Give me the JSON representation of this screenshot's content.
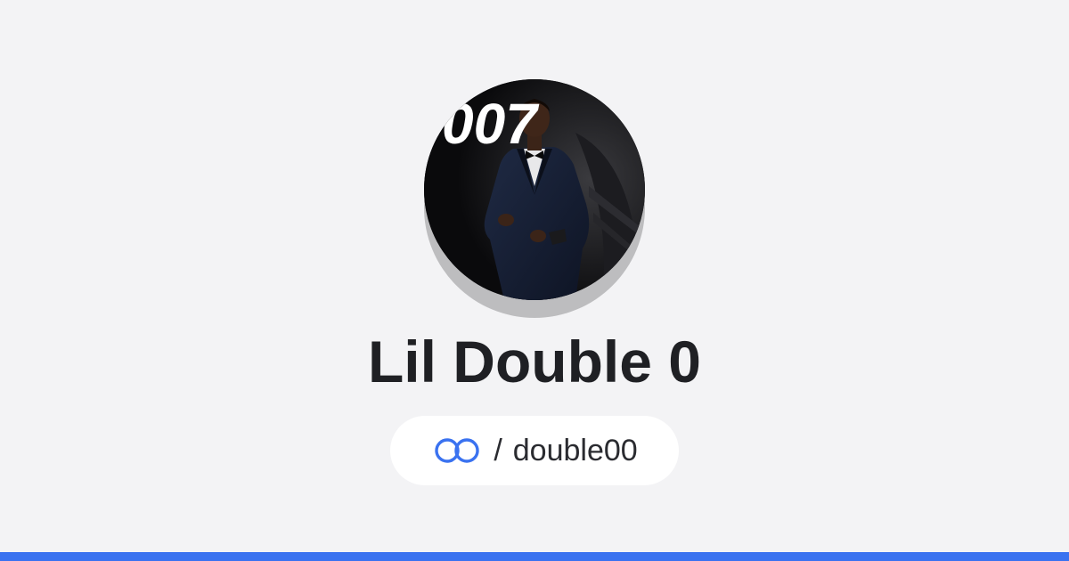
{
  "profile": {
    "display_name": "Lil Double 0",
    "handle_separator": "/",
    "handle": "double00",
    "avatar_overlay_text": "007"
  },
  "icons": {
    "link": "linked-rings-icon"
  },
  "colors": {
    "background": "#f3f3f5",
    "name_text": "#1f2024",
    "accent": "#3a72f0",
    "pill_background": "#ffffff"
  }
}
